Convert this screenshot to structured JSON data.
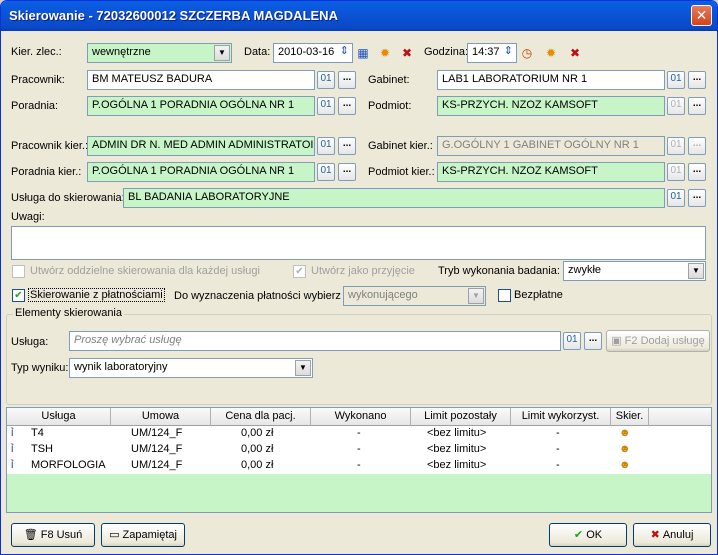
{
  "window": {
    "title": "Skierowanie - 72032600012 SZCZERBA MAGDALENA",
    "close_glyph": "✕"
  },
  "form": {
    "kier_zlec_label": "Kier. zlec.:",
    "kier_zlec_value": "wewnętrzne",
    "data_label": "Data:",
    "data_value": "2010-03-16",
    "godzina_label": "Godzina:",
    "godzina_value": "14:37",
    "pracownik_label": "Pracownik:",
    "pracownik_value": "BM MATEUSZ BADURA",
    "gabinet_label": "Gabinet:",
    "gabinet_value": "LAB1 LABORATORIUM NR 1",
    "poradnia_label": "Poradnia:",
    "poradnia_value": "P.OGÓLNA 1 PORADNIA OGÓLNA NR 1",
    "podmiot_label": "Podmiot:",
    "podmiot_value": "KS-PRZYCH. NZOZ KAMSOFT",
    "pracownik_kier_label": "Pracownik kier.:",
    "pracownik_kier_value": "ADMIN DR N. MED ADMIN ADMINISTRATOI",
    "gabinet_kier_label": "Gabinet kier.:",
    "gabinet_kier_value": "G.OGÓLNY 1 GABINET OGÓLNY NR 1",
    "poradnia_kier_label": "Poradnia kier.:",
    "poradnia_kier_value": "P.OGÓLNA 1 PORADNIA OGÓLNA NR 1",
    "podmiot_kier_label": "Podmiot kier.:",
    "podmiot_kier_value": "KS-PRZYCH. NZOZ KAMSOFT",
    "usluga_do_skier_label": "Usługa do skierowania:",
    "usluga_do_skier_value": "BL BADANIA LABORATORYJNE",
    "uwagi_label": "Uwagi:",
    "uwagi_value": "",
    "cb_oddzielne_label": "Utwórz oddzielne skierowania dla każdej usługi",
    "cb_przyjecie_label": "Utwórz jako przyjęcie",
    "tryb_label": "Tryb wykonania badania:",
    "tryb_value": "zwykłe",
    "cb_platnosci_label": "Skierowanie z płatnościami",
    "do_wyznaczenia_label": "Do wyznaczenia płatności wybierz",
    "do_wyznaczenia_value": "wykonującego",
    "cb_bezplatne_label": "Bezpłatne",
    "dots": "...",
    "lookup_glyph": "01"
  },
  "elementy": {
    "group_title": "Elementy skierowania",
    "usluga_label": "Usługa:",
    "usluga_placeholder": "Proszę wybrać usługę",
    "dodaj_label": "F2 Dodaj usługę",
    "typ_wyniku_label": "Typ wyniku:",
    "typ_wyniku_value": "wynik laboratoryjny"
  },
  "table": {
    "columns": [
      "Usługa",
      "Umowa",
      "Cena dla pacj.",
      "Wykonano",
      "Limit pozostały",
      "Limit wykorzyst.",
      "Skier."
    ],
    "rows": [
      {
        "usluga": "T4",
        "umowa": "UM/124_F",
        "cena": "0,00 zł",
        "wykonano": "-",
        "limit_poz": "<bez limitu>",
        "limit_wyk": "-"
      },
      {
        "usluga": "TSH",
        "umowa": "UM/124_F",
        "cena": "0,00 zł",
        "wykonano": "-",
        "limit_poz": "<bez limitu>",
        "limit_wyk": "-"
      },
      {
        "usluga": "MORFOLOGIA",
        "umowa": "UM/124_F",
        "cena": "0,00 zł",
        "wykonano": "-",
        "limit_poz": "<bez limitu>",
        "limit_wyk": "-"
      }
    ]
  },
  "footer": {
    "usun_label": "F8 Usuń",
    "zapamietaj_label": "Zapamiętaj",
    "ok_label": "OK",
    "anuluj_label": "Anuluj"
  },
  "colors": {
    "accent_green": "#c8f5c8",
    "title_blue": "#0a5fe4"
  }
}
